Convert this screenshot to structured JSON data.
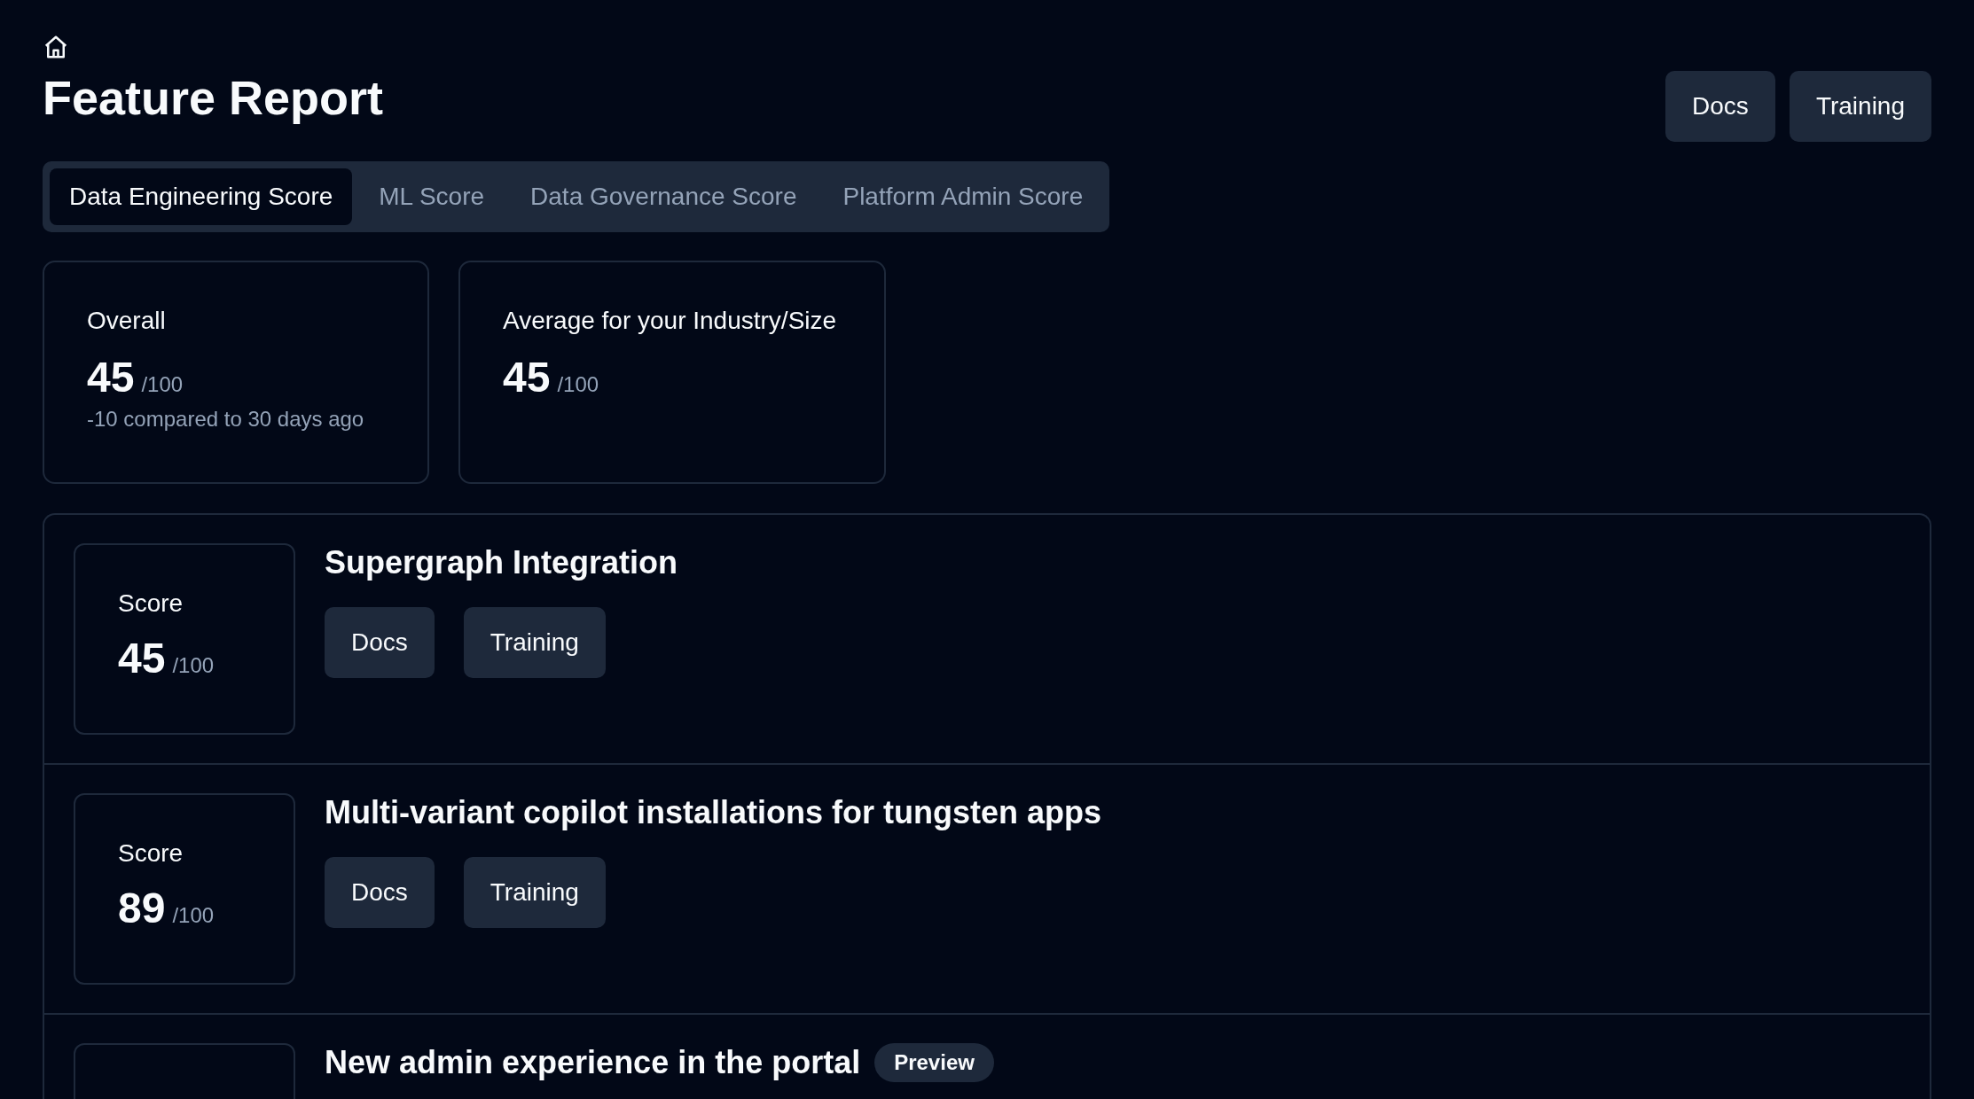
{
  "header": {
    "title": "Feature Report",
    "buttons": [
      "Docs",
      "Training"
    ]
  },
  "tabs": [
    {
      "label": "Data Engineering Score",
      "selected": true
    },
    {
      "label": "ML Score",
      "selected": false
    },
    {
      "label": "Data Governance Score",
      "selected": false
    },
    {
      "label": "Platform Admin Score",
      "selected": false
    }
  ],
  "summary_cards": [
    {
      "label": "Overall",
      "score": "45",
      "max": "/100",
      "note": "-10 compared to 30 days ago"
    },
    {
      "label": "Average for your Industry/Size",
      "score": "45",
      "max": "/100"
    }
  ],
  "features": [
    {
      "title": "Supergraph Integration",
      "score_label": "Score",
      "score": "45",
      "max": "/100",
      "buttons": [
        "Docs",
        "Training"
      ]
    },
    {
      "title": "Multi-variant copilot installations for tungsten apps",
      "score_label": "Score",
      "score": "89",
      "max": "/100",
      "buttons": [
        "Docs",
        "Training"
      ]
    },
    {
      "title": "New admin experience in the portal",
      "badge": "Preview"
    }
  ]
}
